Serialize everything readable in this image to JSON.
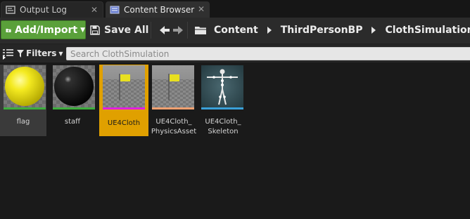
{
  "tabs": [
    {
      "label": "Output Log",
      "icon": "output-log-icon",
      "active": false
    },
    {
      "label": "Content Browser",
      "icon": "content-browser-icon",
      "active": true
    }
  ],
  "toolbar": {
    "add_import_label": "Add/Import",
    "save_all_label": "Save All"
  },
  "breadcrumbs": [
    "Content",
    "ThirdPersonBP",
    "ClothSimulation"
  ],
  "filter": {
    "filters_label": "Filters",
    "search_placeholder": "Search ClothSimulation"
  },
  "assets": [
    {
      "label": "flag",
      "type": "material",
      "thumb_color": "#f0e020",
      "bar_color": "#3eae3e",
      "state": "hovered"
    },
    {
      "label": "staff",
      "type": "material",
      "thumb_color": "#0c0c0c",
      "bar_color": "#3eae3e",
      "state": "normal"
    },
    {
      "label": "UE4Cloth",
      "type": "skeletal-mesh",
      "thumb_color": "#dedc2a",
      "bar_color": "#e020e0",
      "state": "selected"
    },
    {
      "label": "UE4Cloth_\nPhysicsAsset",
      "type": "physics-asset",
      "thumb_color": "#dedc2a",
      "bar_color": "#f0a070",
      "state": "normal"
    },
    {
      "label": "UE4Cloth_\nSkeleton",
      "type": "skeleton",
      "thumb_color": "#d0d0d0",
      "bar_color": "#3aa0d8",
      "state": "normal"
    }
  ],
  "colors": {
    "accent_green": "#5aa03a",
    "selection": "#e0a000",
    "background": "#1a1a1a"
  }
}
